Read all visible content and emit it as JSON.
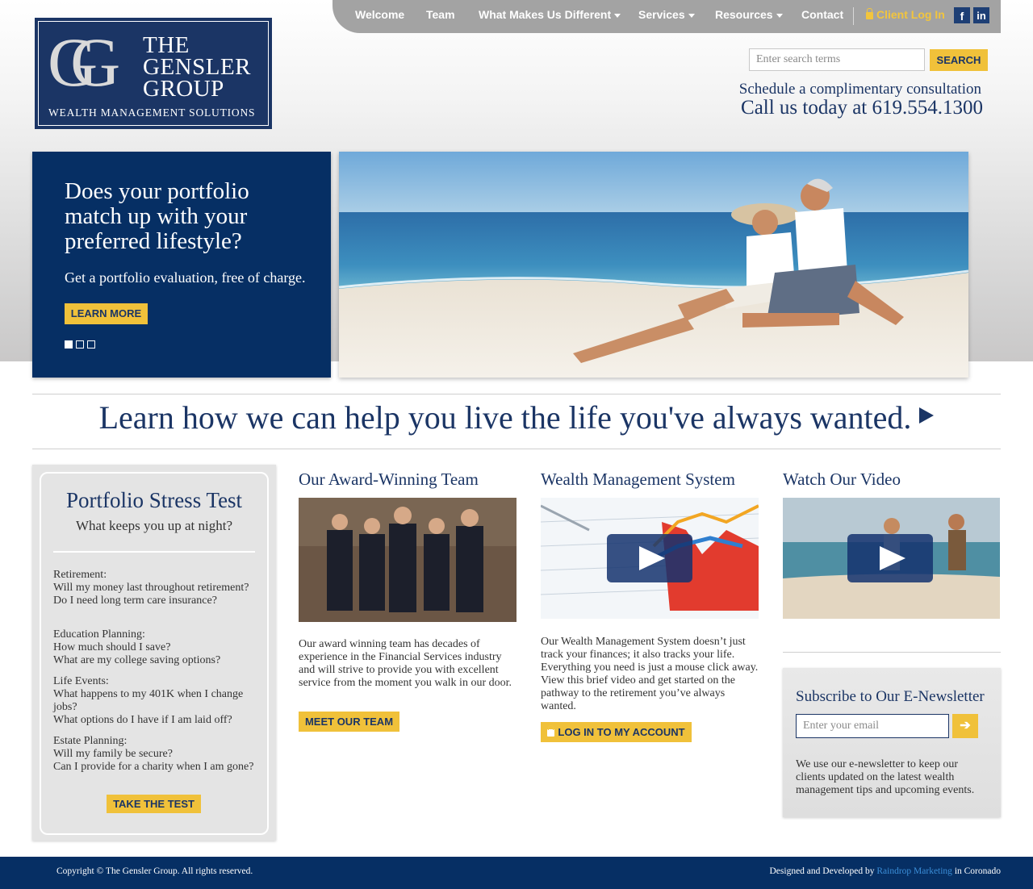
{
  "nav": {
    "items": [
      {
        "label": "Welcome",
        "caret": false
      },
      {
        "label": "Team",
        "caret": false
      },
      {
        "label": "What Makes Us Different",
        "caret": true
      },
      {
        "label": "Services",
        "caret": true
      },
      {
        "label": "Resources",
        "caret": true
      },
      {
        "label": "Contact",
        "caret": false
      }
    ],
    "login_label": "Client Log In",
    "facebook_label": "f",
    "linkedin_label": "in"
  },
  "logo": {
    "mark": "GG",
    "line1": "THE",
    "line2": "GENSLER",
    "line3": "GROUP",
    "subtitle": "WEALTH MANAGEMENT SOLUTIONS"
  },
  "search": {
    "placeholder": "Enter search terms",
    "button_label": "SEARCH"
  },
  "contact": {
    "schedule": "Schedule a complimentary consultation",
    "call": "Call us today at 619.554.1300"
  },
  "hero": {
    "title": "Does your portfolio match up with your preferred lifestyle?",
    "subtitle": "Get a portfolio evaluation, free of charge.",
    "button_label": "LEARN MORE",
    "active_slide": 1,
    "slide_count": 3
  },
  "tagline": "Learn how we can help you live the life you've always wanted.",
  "stress_test": {
    "title": "Portfolio Stress Test",
    "subtitle": "What keeps you up at night?",
    "groups": [
      {
        "heading": "Retirement:",
        "lines": [
          "Will my money last throughout retirement?",
          "Do I need long term care insurance?"
        ]
      },
      {
        "heading": "Education Planning:",
        "lines": [
          "How much should I save?",
          "What are my college saving options?"
        ]
      },
      {
        "heading": "Life Events:",
        "lines": [
          "What happens to my 401K when I change jobs?",
          "What options do I have if I am laid off?"
        ]
      },
      {
        "heading": "Estate Planning:",
        "lines": [
          "Will my family be secure?",
          "Can I provide for a charity when I am gone?"
        ]
      }
    ],
    "button_label": "TAKE THE TEST"
  },
  "team": {
    "title": "Our Award-Winning Team",
    "text": "Our award winning team has decades of experience in the Financial Services industry and will strive to provide you with excellent service from the moment you walk in our door.",
    "button_label": "MEET OUR TEAM"
  },
  "wealth": {
    "title": "Wealth Management System",
    "text": "Our Wealth Management System doesn’t just track your finances; it also tracks your life. Everything you need is just a mouse click away. View this brief video and get started on the pathway to the retirement you’ve always wanted.",
    "button_label": "LOG IN TO MY ACCOUNT"
  },
  "video": {
    "title": "Watch Our Video"
  },
  "newsletter": {
    "title": "Subscribe to Our E-Newsletter",
    "placeholder": "Enter your email",
    "button_label": "➔",
    "text": "We use our e-newsletter to keep our clients updated on the latest wealth management tips and upcoming events."
  },
  "footer": {
    "copyright": "Copyright © The Gensler Group. All rights reserved.",
    "designed_prefix": "Designed and Developed by",
    "designer": "Raindrop Marketing",
    "designed_suffix": "in Coronado"
  }
}
